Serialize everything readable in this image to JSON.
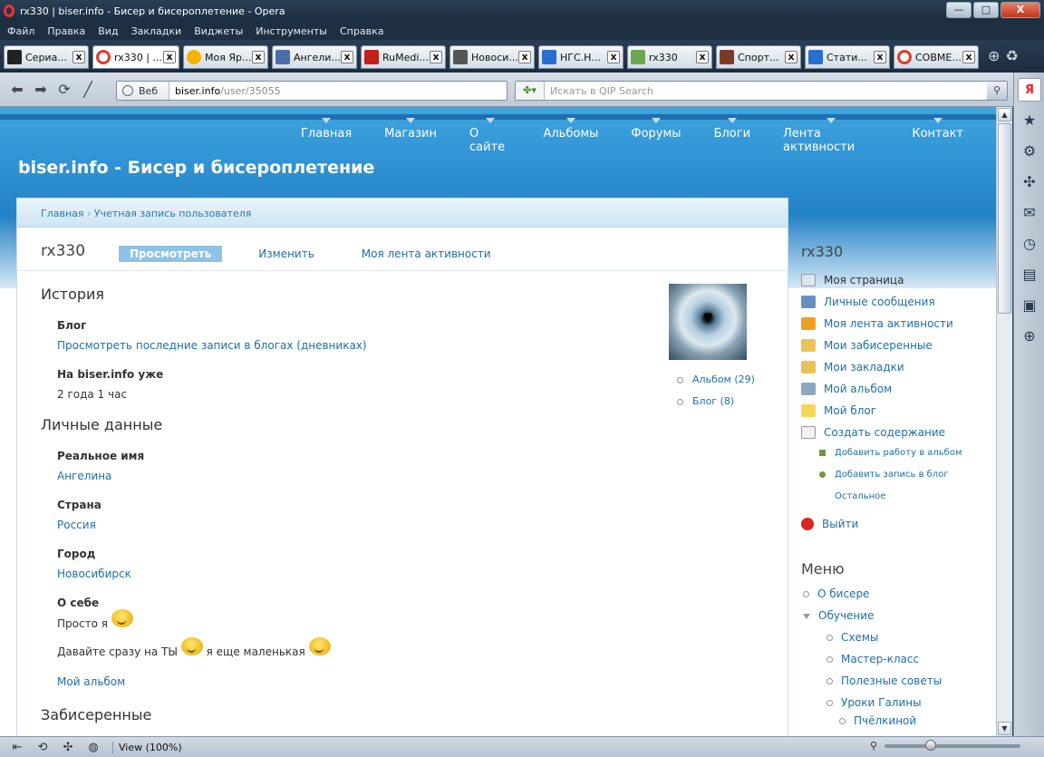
{
  "window": {
    "title": "rx330 | biser.info - Бисер и бисероплетение - Opera",
    "buttons": {
      "minimize": "—",
      "maximize": "□",
      "close": "X"
    }
  },
  "menubar": [
    "Файл",
    "Правка",
    "Вид",
    "Закладки",
    "Виджеты",
    "Инструменты",
    "Справка"
  ],
  "tabs": [
    {
      "label": "Сериа...",
      "color": "#222222"
    },
    {
      "label": "rx330 | ...",
      "color": "#e23a2a"
    },
    {
      "label": "Моя Яр...",
      "color": "#f2b400"
    },
    {
      "label": "Ангели...",
      "color": "#4a6fa8"
    },
    {
      "label": "RuMedi...",
      "color": "#c4201a"
    },
    {
      "label": "Новоси...",
      "color": "#555555"
    },
    {
      "label": "НГС.Н...",
      "color": "#2a6fd0"
    },
    {
      "label": "rx330",
      "color": "#6aa84f"
    },
    {
      "label": "Спорт...",
      "color": "#7b3b2a"
    },
    {
      "label": "Стати...",
      "color": "#2a6fd0"
    },
    {
      "label": "СОВМЕ...",
      "color": "#e23a2a"
    }
  ],
  "tab_close": "x",
  "toolbar": {
    "address_label": "Веб",
    "url_host": "biser.info",
    "url_path": "/user/35055",
    "search_placeholder": "Искать в QIP Search"
  },
  "status": {
    "zoom": "View (100%)",
    "zoom_level_percent": 100
  },
  "site": {
    "title": "biser.info - Бисер и бисероплетение",
    "nav": [
      "Главная",
      "Магазин",
      "О сайте",
      "Альбомы",
      "Форумы",
      "Блоги",
      "Лента активности",
      "Контакт"
    ]
  },
  "breadcrumb": {
    "home": "Главная",
    "sep": "›",
    "current": "Учетная запись пользователя"
  },
  "user": {
    "name": "rx330",
    "tabs": [
      "Просмотреть",
      "Изменить",
      "Моя лента активности"
    ],
    "sections": {
      "history": "История",
      "personal": "Личные данные",
      "beaded": "Забисеренные"
    },
    "fields": {
      "blog_label": "Блог",
      "blog_value": "Просмотреть последние записи в блогах (дневниках)",
      "member_label": "На biser.info уже",
      "member_value": "2 года 1 час",
      "realname_label": "Реальное имя",
      "realname_value": "Ангелина",
      "country_label": "Страна",
      "country_value": "Россия",
      "city_label": "Город",
      "city_value": "Новосибирск",
      "about_label": "О себе",
      "about_line1": "Просто я",
      "about_line2a": "Давайте сразу на ТЫ",
      "about_line2b": "я еще маленькая",
      "about_link": "Мой альбом"
    },
    "side_links": [
      "Альбом (29)",
      "Блог (8)"
    ]
  },
  "right": {
    "user_heading": "rx330",
    "my_page": "Моя страница",
    "items": [
      "Личные сообщения",
      "Моя лента активности",
      "Мои забисеренные",
      "Мои закладки",
      "Мой альбом",
      "Мой блог",
      "Создать содержание"
    ],
    "sub_items": [
      "Добавить работу в альбом",
      "Добавить запись в блог",
      "Остальное"
    ],
    "logout": "Выйти",
    "menu_heading": "Меню",
    "menu": [
      "О бисере",
      "Обучение"
    ],
    "menu_sub": [
      "Схемы",
      "Мастер-класс",
      "Полезные советы",
      "Уроки Галины",
      "Пчёлкиной"
    ]
  }
}
